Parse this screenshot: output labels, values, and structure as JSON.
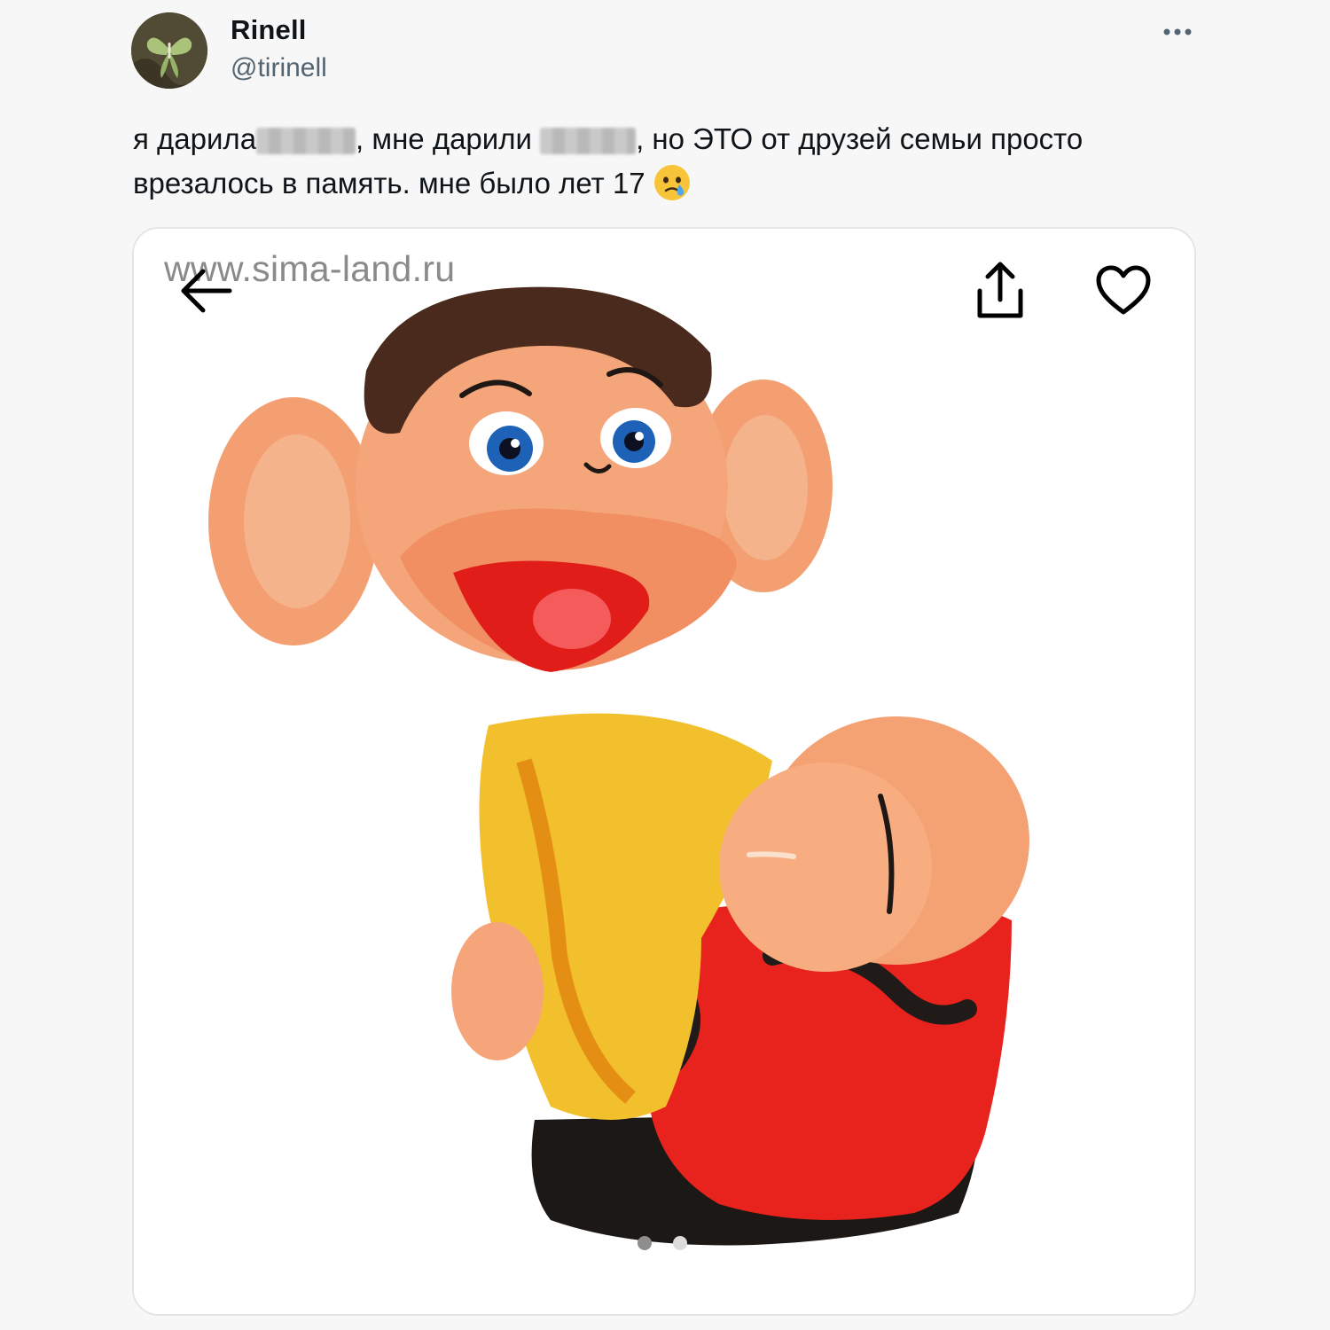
{
  "tweet": {
    "author": {
      "display_name": "Rinell",
      "handle": "@tirinell",
      "avatar_icon": "moth-avatar"
    },
    "more_icon": "more-horizontal-icon",
    "text": {
      "part1": "я дарила",
      "part2": ", мне дарили",
      "part3": ", но ЭТО от друзей семьи просто врезалось в память. мне было лет 17",
      "emoji": "face-holding-back-tears"
    },
    "media": {
      "watermark": "www.sima-land.ru",
      "back_icon": "arrow-left-icon",
      "share_icon": "share-icon",
      "like_icon": "heart-icon",
      "page_count": 2,
      "active_page": 1
    }
  },
  "colors": {
    "background": "#f7f7f7",
    "text_primary": "#0f1419",
    "text_secondary": "#536471",
    "card_border": "#e3e6e8"
  }
}
